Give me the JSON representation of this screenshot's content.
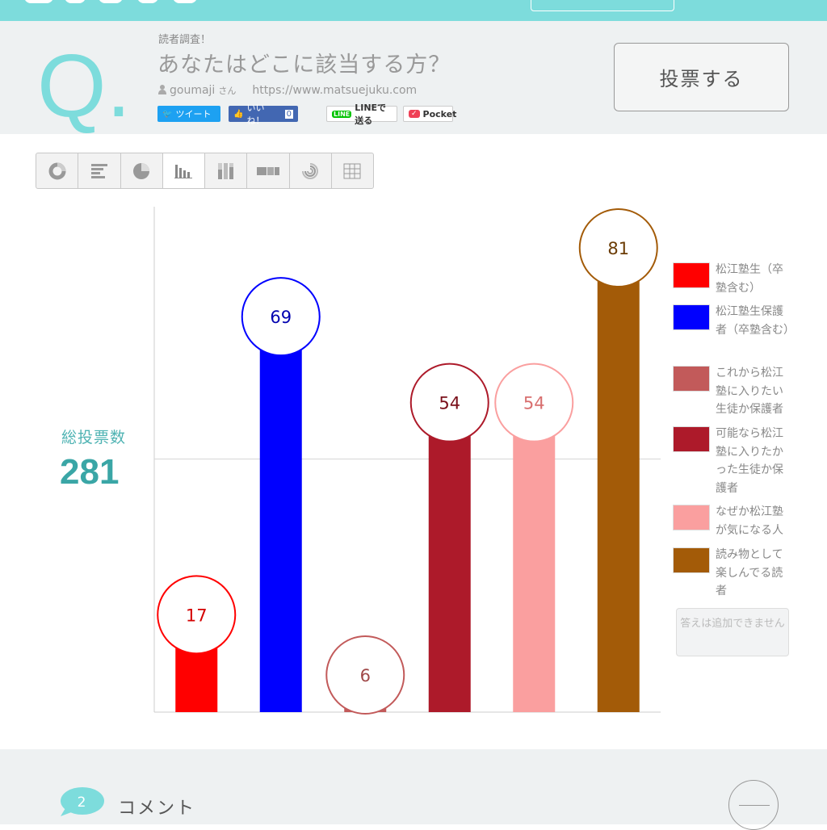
{
  "header": {
    "q_letter": "Q",
    "q_dot": ".",
    "category": "読者調査！",
    "question": "あなたはどこに該当する方？",
    "author": "goumaji",
    "author_suffix": "さん",
    "url": "https://www.matsuejuku.com",
    "vote_button": "投票する"
  },
  "share": {
    "tweet": "ツイート",
    "like": "いいね！",
    "like_count": "0",
    "line": "LINEで送る",
    "line_icon": "LINE",
    "pocket": "Pocket"
  },
  "chart_tabs": [
    {
      "icon": "donut-chart-icon"
    },
    {
      "icon": "horizontal-bar-icon"
    },
    {
      "icon": "pie-chart-icon"
    },
    {
      "icon": "vertical-bar-icon",
      "active": true
    },
    {
      "icon": "stacked-bar-icon"
    },
    {
      "icon": "stacked-horizontal-icon"
    },
    {
      "icon": "radial-chart-icon"
    },
    {
      "icon": "table-icon"
    }
  ],
  "summary": {
    "total_label": "総投票数",
    "total_value": "281"
  },
  "legend": {
    "no_add": "答えは追加できません"
  },
  "chart_data": {
    "type": "bar",
    "categories": [
      "松江塾生（卒塾含む）",
      "松江塾生保護者（卒塾含む）",
      "これから松江塾に入りたい生徒か保護者",
      "可能なら松江塾に入りたかった生徒か保護者",
      "なぜか松江塾が気になる人",
      "読み物として楽しんでる読者"
    ],
    "values": [
      17,
      69,
      6,
      54,
      54,
      81
    ],
    "colors": [
      "#ff0000",
      "#0000ff",
      "#c25a5a",
      "#ad1a2a",
      "#fa9f9f",
      "#a35b08"
    ],
    "label_colors": [
      "#d40000",
      "#0000b0",
      "#a04848",
      "#7a0f1a",
      "#d86f6f",
      "#6b3c05"
    ],
    "title": "",
    "xlabel": "",
    "ylabel": "",
    "ylim": [
      0,
      81
    ],
    "grid": "single horizontal line at midpoint",
    "legend_position": "right"
  },
  "comments": {
    "count": "2",
    "label": "コメント"
  }
}
